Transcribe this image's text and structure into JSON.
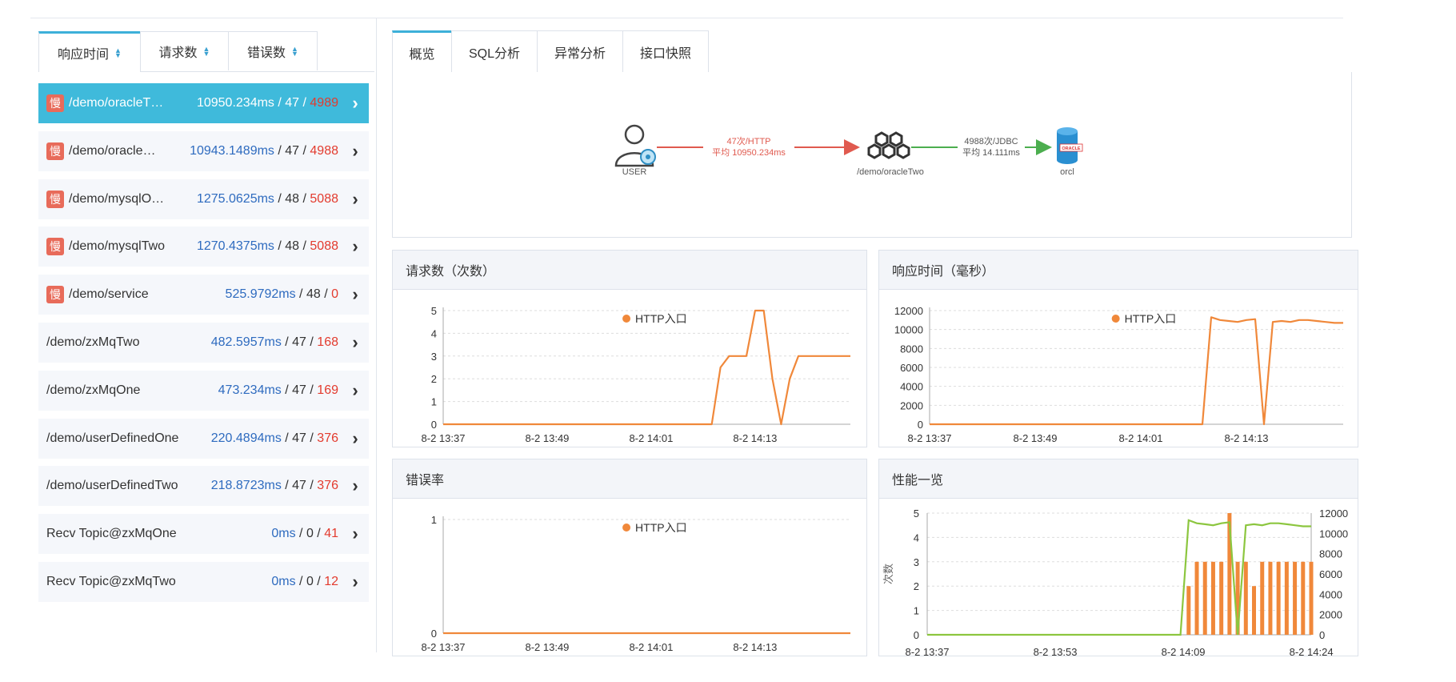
{
  "left_tabs": [
    {
      "label": "响应时间",
      "sort_icon": "sort-icon"
    },
    {
      "label": "请求数",
      "sort_icon": "sort-icon"
    },
    {
      "label": "错误数",
      "sort_icon": "sort-icon"
    }
  ],
  "endpoints": [
    {
      "slow": true,
      "name": "/demo/oracleT…",
      "time": "10950.234ms",
      "requests": "47",
      "errors": "4989",
      "selected": true
    },
    {
      "slow": true,
      "name": "/demo/oracle…",
      "time": "10943.1489ms",
      "requests": "47",
      "errors": "4988",
      "selected": false
    },
    {
      "slow": true,
      "name": "/demo/mysqlO…",
      "time": "1275.0625ms",
      "requests": "48",
      "errors": "5088",
      "selected": false
    },
    {
      "slow": true,
      "name": "/demo/mysqlTwo",
      "time": "1270.4375ms",
      "requests": "48",
      "errors": "5088",
      "selected": false
    },
    {
      "slow": true,
      "name": "/demo/service",
      "time": "525.9792ms",
      "requests": "48",
      "errors": "0",
      "selected": false
    },
    {
      "slow": false,
      "name": "/demo/zxMqTwo",
      "time": "482.5957ms",
      "requests": "47",
      "errors": "168",
      "selected": false
    },
    {
      "slow": false,
      "name": "/demo/zxMqOne",
      "time": "473.234ms",
      "requests": "47",
      "errors": "169",
      "selected": false
    },
    {
      "slow": false,
      "name": "/demo/userDefinedOne",
      "time": "220.4894ms",
      "requests": "47",
      "errors": "376",
      "selected": false
    },
    {
      "slow": false,
      "name": "/demo/userDefinedTwo",
      "time": "218.8723ms",
      "requests": "47",
      "errors": "376",
      "selected": false
    },
    {
      "slow": false,
      "name": "Recv Topic@zxMqOne",
      "time": "0ms",
      "requests": "0",
      "errors": "41",
      "selected": false
    },
    {
      "slow": false,
      "name": "Recv Topic@zxMqTwo",
      "time": "0ms",
      "requests": "0",
      "errors": "12",
      "selected": false
    }
  ],
  "slow_badge": "慢",
  "stat_sep": " / ",
  "right_tabs": [
    {
      "label": "概览"
    },
    {
      "label": "SQL分析"
    },
    {
      "label": "异常分析"
    },
    {
      "label": "接口快照"
    }
  ],
  "topology": {
    "user_label": "USER",
    "http_edge_line1": "47次/HTTP",
    "http_edge_line2": "平均 10950.234ms",
    "service_label": "/demo/oracleTwo",
    "jdbc_edge_line1": "4988次/JDBC",
    "jdbc_edge_line2": "平均 14.111ms",
    "db_label": "orcl",
    "db_logo_text": "ORACLE",
    "http_color": "#e05a4f",
    "jdbc_color": "#4cae4f"
  },
  "colors": {
    "accent": "#3fbadb",
    "series_orange": "#f0883a",
    "series_green": "#8cc63f",
    "time_blue": "#2e6bbf",
    "error_red": "#e33b2e"
  },
  "chart_data": [
    {
      "type": "line",
      "title": "请求数（次数）",
      "legend": [
        "HTTP入口"
      ],
      "x_ticks": [
        "8-2 13:37",
        "8-2 13:49",
        "8-2 14:01",
        "8-2 14:13"
      ],
      "y_ticks": [
        "0",
        "1",
        "2",
        "3",
        "4",
        "5"
      ],
      "ylim": [
        0,
        5
      ],
      "x_range_minutes": [
        0,
        47
      ],
      "series": [
        {
          "name": "HTTP入口",
          "x": [
            0,
            31,
            32,
            33,
            35,
            36,
            37,
            38,
            39,
            40,
            41,
            42,
            47
          ],
          "values": [
            0,
            0,
            2.5,
            3,
            3,
            5,
            5,
            2,
            0,
            2,
            3,
            3,
            3
          ]
        }
      ]
    },
    {
      "type": "line",
      "title": "响应时间（毫秒）",
      "legend": [
        "HTTP入口"
      ],
      "x_ticks": [
        "8-2 13:37",
        "8-2 13:49",
        "8-2 14:01",
        "8-2 14:13"
      ],
      "y_ticks": [
        "0",
        "2000",
        "4000",
        "6000",
        "8000",
        "10000",
        "12000"
      ],
      "ylim": [
        0,
        12000
      ],
      "x_range_minutes": [
        0,
        47
      ],
      "series": [
        {
          "name": "HTTP入口",
          "x": [
            0,
            31,
            32,
            33,
            34,
            35,
            36,
            37,
            38,
            39,
            40,
            41,
            42,
            43,
            44,
            45,
            46,
            47
          ],
          "values": [
            0,
            0,
            11300,
            11000,
            10900,
            10800,
            11000,
            11100,
            0,
            10800,
            10900,
            10800,
            11000,
            11000,
            10900,
            10800,
            10700,
            10700
          ]
        }
      ]
    },
    {
      "type": "line",
      "title": "错误率",
      "legend": [
        "HTTP入口"
      ],
      "x_ticks": [
        "8-2 13:37",
        "8-2 13:49",
        "8-2 14:01",
        "8-2 14:13"
      ],
      "y_ticks": [
        "0",
        "1"
      ],
      "ylim": [
        0,
        1
      ],
      "x_range_minutes": [
        0,
        47
      ],
      "series": [
        {
          "name": "HTTP入口",
          "x": [
            0,
            47
          ],
          "values": [
            0,
            0
          ]
        }
      ]
    },
    {
      "type": "bar+line",
      "title": "性能一览",
      "ylabel_left": "次数",
      "x_ticks": [
        "8-2 13:37",
        "8-2 13:53",
        "8-2 14:09",
        "8-2 14:24"
      ],
      "y_ticks_left": [
        "0",
        "1",
        "2",
        "3",
        "4",
        "5"
      ],
      "y_ticks_right": [
        "0",
        "2000",
        "4000",
        "6000",
        "8000",
        "10000",
        "12000"
      ],
      "ylim_left": [
        0,
        5
      ],
      "ylim_right": [
        0,
        12000
      ],
      "bars": [
        2,
        3,
        3,
        3,
        3,
        5,
        3,
        3,
        2,
        3,
        3,
        3,
        3,
        3,
        3,
        3
      ],
      "line_x": [
        0,
        31,
        32,
        33,
        34,
        35,
        36,
        37,
        38,
        39,
        40,
        41,
        42,
        43,
        44,
        45,
        46,
        47
      ],
      "line_values": [
        0,
        0,
        11300,
        11000,
        10900,
        10800,
        11000,
        11100,
        0,
        10800,
        10900,
        10800,
        11000,
        11000,
        10900,
        10800,
        10700,
        10700
      ]
    }
  ]
}
